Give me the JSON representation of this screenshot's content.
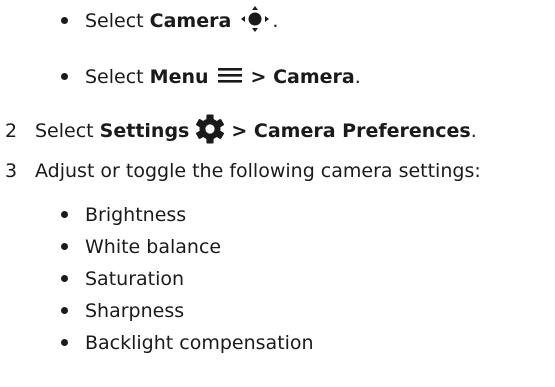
{
  "steps": {
    "option_camera": {
      "prefix": "Select ",
      "bold": "Camera",
      "icon": "camera-nav-icon",
      "suffix": "."
    },
    "option_menu": {
      "prefix": "Select ",
      "bold": "Menu",
      "icon": "hamburger-menu-icon",
      "path": "> Camera",
      "suffix": "."
    },
    "step2": {
      "number": "2",
      "prefix": "Select ",
      "bold": "Settings",
      "icon": "gear-icon",
      "path": "> Camera Preferences",
      "suffix": "."
    },
    "step3": {
      "number": "3",
      "text": "Adjust or toggle the following camera settings:"
    }
  },
  "settings_list": [
    "Brightness",
    "White balance",
    "Saturation",
    "Sharpness",
    "Backlight compensation"
  ]
}
